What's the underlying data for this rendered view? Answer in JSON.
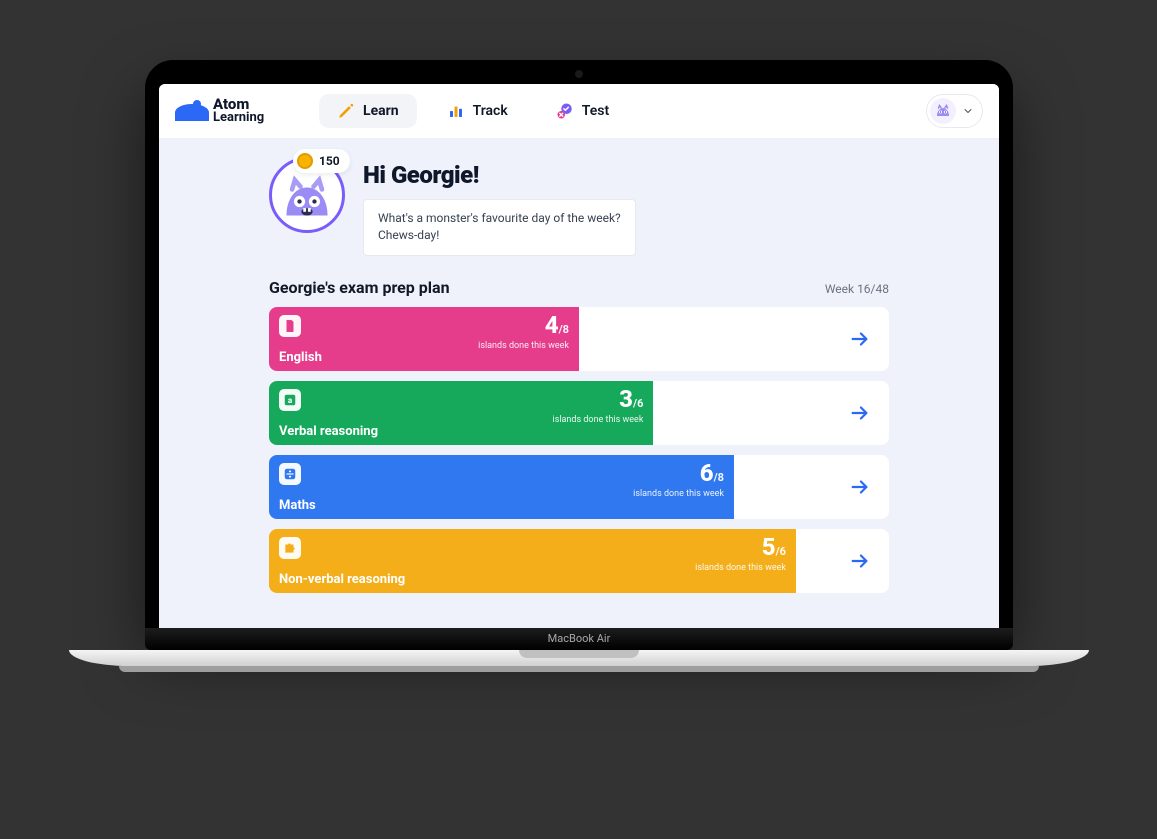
{
  "device_label": "MacBook Air",
  "brand": {
    "line1": "Atom",
    "line2": "Learning"
  },
  "nav": {
    "learn": "Learn",
    "track": "Track",
    "test": "Test"
  },
  "coins": "150",
  "greeting": "Hi Georgie!",
  "joke_line1": "What's a monster's favourite day of the week?",
  "joke_line2": "Chews-day!",
  "plan": {
    "title": "Georgie's exam prep plan",
    "week": "Week 16/48",
    "islands_label": "islands done this week",
    "subjects": [
      {
        "name": "English",
        "done": "4",
        "total": "/8",
        "color": "#e63c8c",
        "fill_pct": 50,
        "icon": "file"
      },
      {
        "name": "Verbal reasoning",
        "done": "3",
        "total": "/6",
        "color": "#17a95b",
        "fill_pct": 62,
        "icon": "letter"
      },
      {
        "name": "Maths",
        "done": "6",
        "total": "/8",
        "color": "#2f78ef",
        "fill_pct": 75,
        "icon": "divide"
      },
      {
        "name": "Non-verbal reasoning",
        "done": "5",
        "total": "/6",
        "color": "#f4ae1a",
        "fill_pct": 85,
        "icon": "puzzle"
      }
    ]
  }
}
